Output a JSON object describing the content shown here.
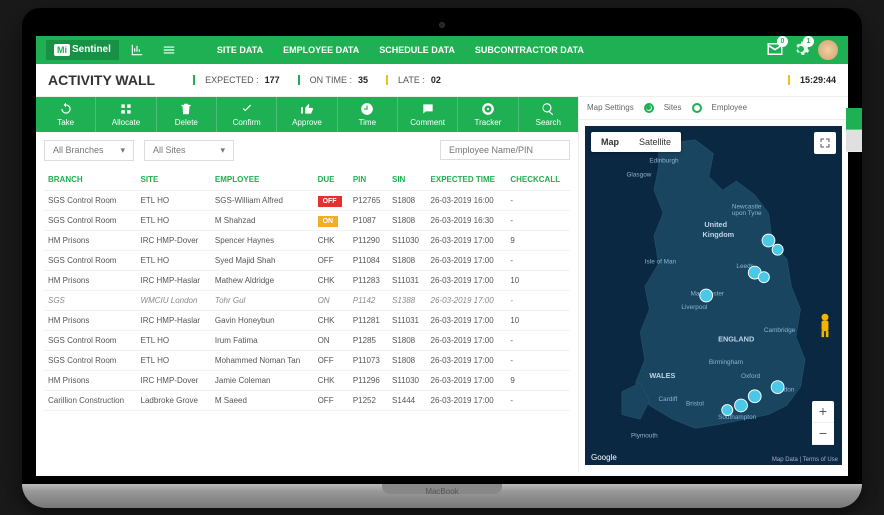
{
  "brand": {
    "part1": "Mi",
    "part2": "Sentinel"
  },
  "nav": [
    "SITE DATA",
    "EMPLOYEE DATA",
    "SCHEDULE DATA",
    "SUBCONTRACTOR DATA"
  ],
  "notifications": {
    "mail": "0",
    "gear": "1"
  },
  "page_title": "ACTIVITY WALL",
  "stats": {
    "expected": {
      "label": "EXPECTED :",
      "value": "177"
    },
    "ontime": {
      "label": "ON TIME :",
      "value": "35"
    },
    "late": {
      "label": "LATE :",
      "value": "02"
    },
    "time": "15:29:44"
  },
  "tools": [
    "Take",
    "Allocate",
    "Delete",
    "Confirm",
    "Approve",
    "Time",
    "Comment",
    "Tracker",
    "Search"
  ],
  "filters": {
    "branches": "All Branches",
    "sites": "All Sites",
    "search_placeholder": "Employee Name/PIN"
  },
  "columns": [
    "BRANCH",
    "SITE",
    "EMPLOYEE",
    "DUE",
    "PIN",
    "SIN",
    "EXPECTED TIME",
    "CHECKCALL"
  ],
  "rows": [
    {
      "branch": "SGS Control Room",
      "site": "ETL HO",
      "emp": "SGS-William Alfred",
      "due": "OFF",
      "due_cls": "off",
      "pin": "P12765",
      "sin": "S1808",
      "time": "26-03-2019 16:00",
      "check": "-",
      "italic": false
    },
    {
      "branch": "SGS Control Room",
      "site": "ETL HO",
      "emp": "M Shahzad",
      "due": "ON",
      "due_cls": "on",
      "pin": "P1087",
      "sin": "S1808",
      "time": "26-03-2019 16:30",
      "check": "-",
      "italic": false
    },
    {
      "branch": "HM Prisons",
      "site": "IRC HMP-Dover",
      "emp": "Spencer Haynes",
      "due": "CHK",
      "due_cls": "",
      "pin": "P11290",
      "sin": "S11030",
      "time": "26-03-2019 17:00",
      "check": "9",
      "italic": false
    },
    {
      "branch": "SGS Control Room",
      "site": "ETL HO",
      "emp": "Syed Majid Shah",
      "due": "OFF",
      "due_cls": "",
      "pin": "P11084",
      "sin": "S1808",
      "time": "26-03-2019 17:00",
      "check": "-",
      "italic": false
    },
    {
      "branch": "HM Prisons",
      "site": "IRC HMP-Haslar",
      "emp": "Mathew Aldridge",
      "due": "CHK",
      "due_cls": "",
      "pin": "P11283",
      "sin": "S11031",
      "time": "26-03-2019 17:00",
      "check": "10",
      "italic": false
    },
    {
      "branch": "SGS",
      "site": "WMCIU London",
      "emp": "Tohr Gul",
      "due": "ON",
      "due_cls": "",
      "pin": "P1142",
      "sin": "S1388",
      "time": "26-03-2019 17:00",
      "check": "-",
      "italic": true
    },
    {
      "branch": "HM Prisons",
      "site": "IRC HMP-Haslar",
      "emp": "Gavin Honeybun",
      "due": "CHK",
      "due_cls": "",
      "pin": "P11281",
      "sin": "S11031",
      "time": "26-03-2019 17:00",
      "check": "10",
      "italic": false
    },
    {
      "branch": "SGS Control Room",
      "site": "ETL HO",
      "emp": "Irum Fatima",
      "due": "ON",
      "due_cls": "",
      "pin": "P1285",
      "sin": "S1808",
      "time": "26-03-2019 17:00",
      "check": "-",
      "italic": false
    },
    {
      "branch": "SGS Control Room",
      "site": "ETL HO",
      "emp": "Mohammed Noman Tan",
      "due": "OFF",
      "due_cls": "",
      "pin": "P11073",
      "sin": "S1808",
      "time": "26-03-2019 17:00",
      "check": "-",
      "italic": false
    },
    {
      "branch": "HM Prisons",
      "site": "IRC HMP-Dover",
      "emp": "Jamie Coleman",
      "due": "CHK",
      "due_cls": "",
      "pin": "P11296",
      "sin": "S11030",
      "time": "26-03-2019 17:00",
      "check": "9",
      "italic": false
    },
    {
      "branch": "Carillion Construction",
      "site": "Ladbroke Grove",
      "emp": "M Saeed",
      "due": "OFF",
      "due_cls": "",
      "pin": "P1252",
      "sin": "S1444",
      "time": "26-03-2019 17:00",
      "check": "-",
      "italic": false
    }
  ],
  "map": {
    "settings_label": "Map Settings",
    "opt_sites": "Sites",
    "opt_employee": "Employee",
    "tab_map": "Map",
    "tab_sat": "Satellite",
    "attribution": "Google",
    "terms": "Map Data | Terms of Use",
    "cities": [
      "Edinburgh",
      "Glasgow",
      "Newcastle upon Tyne",
      "Isle of Man",
      "Leeds",
      "Manchester",
      "Liverpool",
      "Birmingham",
      "Cardiff",
      "Bristol",
      "Plymouth",
      "Southampton",
      "London",
      "Oxford",
      "Cambridge"
    ],
    "regions": [
      "United Kingdom",
      "ENGLAND",
      "WALES"
    ]
  }
}
